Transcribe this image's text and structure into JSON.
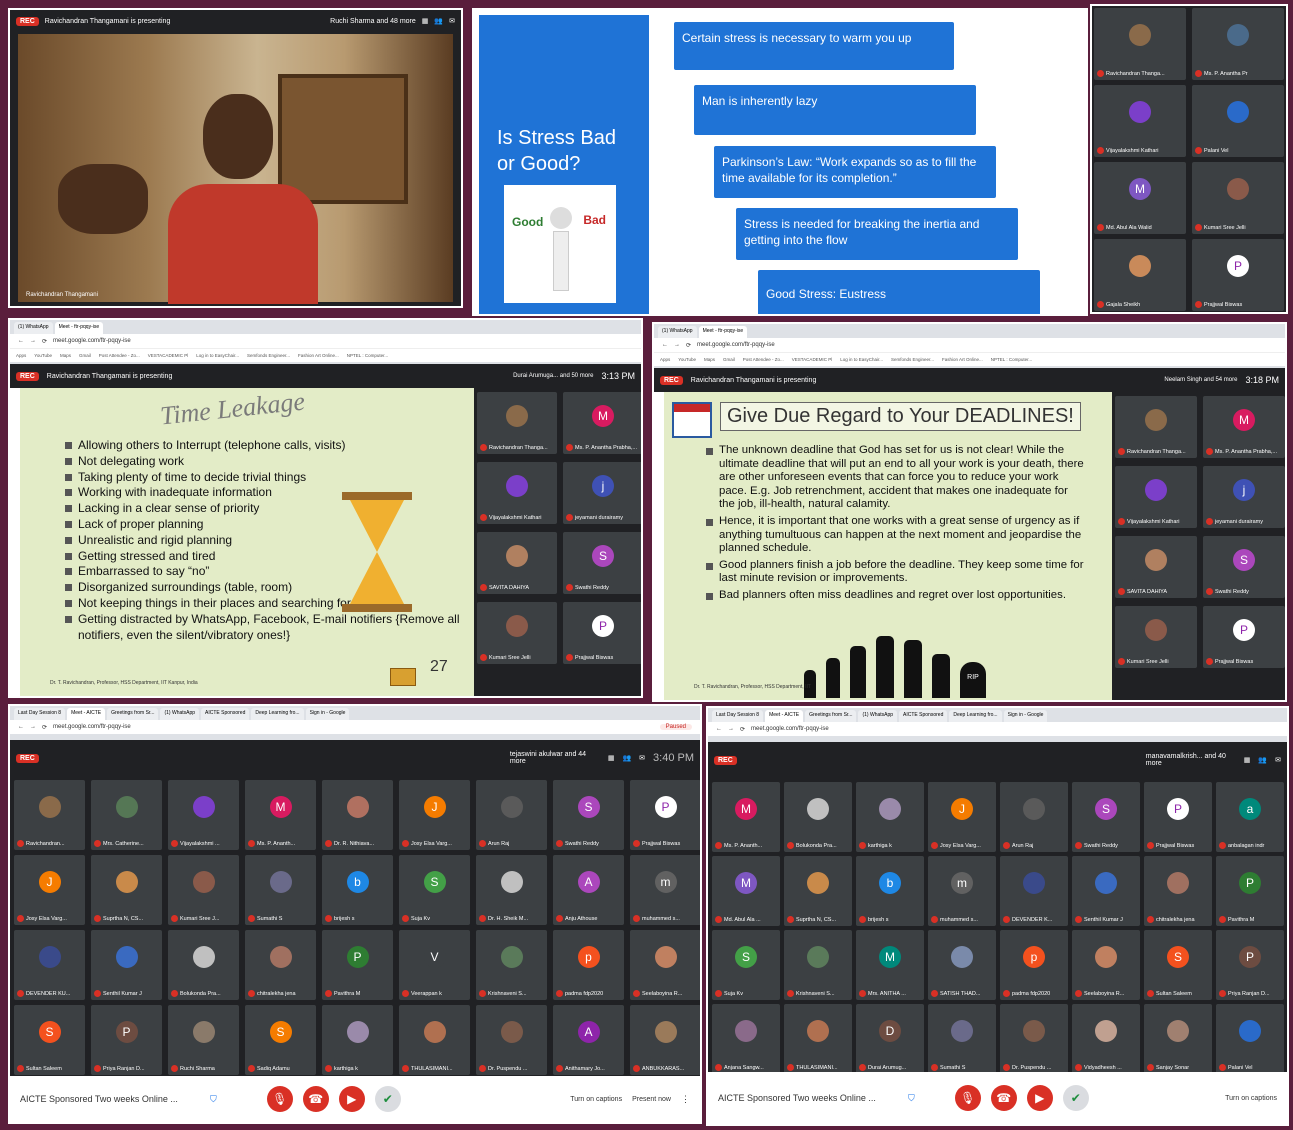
{
  "panel1": {
    "rec": "REC",
    "presenting": "Ravichandran Thangamani is presenting",
    "viewer": "Ruchi Sharma and 48 more",
    "name_tag": "Ravichandran Thangamani"
  },
  "panel2": {
    "title": "Is Stress Bad or Good?",
    "good": "Good",
    "bad": "Bad",
    "boxes": [
      "Certain stress is necessary to warm you up",
      "Man is inherently lazy",
      "Parkinson’s Law: “Work expands so as to fill the time available for its completion.”",
      "Stress is needed for breaking the inertia and getting into the flow",
      "Good Stress: Eustress"
    ]
  },
  "panel3": {
    "tiles": [
      {
        "name": "Ravichandran Thanga...",
        "letter": "",
        "color": "#8a6a4a"
      },
      {
        "name": "Ms. P. Anantha Pr",
        "letter": "",
        "color": "#4a6a8a"
      },
      {
        "name": "Vijayalakshmi Kathari",
        "letter": "",
        "color": "#7b3fc9"
      },
      {
        "name": "Palani Vel",
        "letter": "",
        "color": "#2a6ac9"
      },
      {
        "name": "Md. Abul Ala Walid",
        "letter": "M",
        "color": "#7e57c2"
      },
      {
        "name": "Kumari Sree Jelli",
        "letter": "",
        "color": "#8a5a4a"
      },
      {
        "name": "Gajala Sheikh",
        "letter": "",
        "color": "#c98a5a"
      },
      {
        "name": "Prajjwal Biswas",
        "letter": "P",
        "color": "#ffffff"
      }
    ]
  },
  "panel4": {
    "tabs": [
      "(1) WhatsApp",
      "Meet - ftr-pqqy-ise"
    ],
    "url": "meet.google.com/ftr-pqqy-ise",
    "bookmarks": [
      "Apps",
      "YouTube",
      "Maps",
      "Gmail",
      "Post Attendee - Zo...",
      "VESTACADEMIC Pl",
      "Log in to EasyChair...",
      "Semfonds Engineer...",
      "Fashion Art Online...",
      "NPTEL : Computer..."
    ],
    "rec": "REC",
    "presenting": "Ravichandran Thangamani is presenting",
    "viewer": "Durai Arumuga... and 50 more",
    "time": "3:13 PM",
    "slide_title": "Time Leakage",
    "bullets": [
      "Allowing others to Interrupt (telephone calls, visits)",
      "Not delegating work",
      "Taking plenty of time to decide trivial things",
      "Working with inadequate information",
      "Lacking in a clear sense of priority",
      "Lack of proper planning",
      "Unrealistic and rigid planning",
      "Getting stressed and tired",
      "Embarrassed to say “no”",
      "Disorganized surroundings (table, room)",
      "Not keeping things in their places and searching for them",
      "Getting distracted by WhatsApp, Facebook, E-mail notifiers {Remove all notifiers, even the silent/vibratory ones!}"
    ],
    "page_num": "27",
    "footer": "Dr. T. Ravichandran, Professor, HSS Department, IIT Kanpur, India",
    "tiles": [
      {
        "name": "Ravichandran Thanga...",
        "letter": "",
        "color": "#8a6a4a"
      },
      {
        "name": "Ms. P. Anantha Prabha,...",
        "letter": "M",
        "color": "#d81b60"
      },
      {
        "name": "Vijayalakshmi Kathari",
        "letter": "",
        "color": "#7b3fc9"
      },
      {
        "name": "jeyamani durairamy",
        "letter": "j",
        "color": "#3f51b5"
      },
      {
        "name": "SAVITA DAHIYA",
        "letter": "",
        "color": "#b08060"
      },
      {
        "name": "Swathi Reddy",
        "letter": "S",
        "color": "#ab47bc"
      },
      {
        "name": "Kumari Sree Jelli",
        "letter": "",
        "color": "#8a5a4a"
      },
      {
        "name": "Prajjwal Biswas",
        "letter": "P",
        "color": "#ffffff"
      }
    ]
  },
  "panel5": {
    "tabs": [
      "(1) WhatsApp",
      "Meet - ftr-pqqy-ise"
    ],
    "url": "meet.google.com/ftr-pqqy-ise",
    "rec": "REC",
    "presenting": "Ravichandran Thangamani is presenting",
    "viewer": "Neelam Singh and 54 more",
    "time": "3:18 PM",
    "slide_title": "Give Due Regard to Your DEADLINES!",
    "bullets": [
      "The unknown deadline that God has set for us is not clear! While the ultimate deadline that will put an end to all your work is your death, there are other unforeseen events that can force you to reduce your work pace. E.g. Job retrenchment, accident that makes one inadequate for the job, ill-health, natural calamity.",
      "Hence, it is important that one works with a great sense of urgency as if anything tumultuous can happen at the next moment and jeopardise the planned schedule.",
      "Good planners finish a job before the deadline. They keep some time for last minute revision or improvements.",
      "Bad planners often miss deadlines and regret over lost opportunities."
    ],
    "rip": "RIP",
    "footer": "Dr. T. Ravichandran, Professor, HSS Department, IIT",
    "tiles": [
      {
        "name": "Ravichandran Thanga...",
        "letter": "",
        "color": "#8a6a4a"
      },
      {
        "name": "Ms. P. Anantha Prabha,...",
        "letter": "M",
        "color": "#d81b60"
      },
      {
        "name": "Vijayalakshmi Kathari",
        "letter": "",
        "color": "#7b3fc9"
      },
      {
        "name": "jeyamani durairamy",
        "letter": "j",
        "color": "#3f51b5"
      },
      {
        "name": "SAVITA DAHIYA",
        "letter": "",
        "color": "#b08060"
      },
      {
        "name": "Swathi Reddy",
        "letter": "S",
        "color": "#ab47bc"
      },
      {
        "name": "Kumari Sree Jelli",
        "letter": "",
        "color": "#8a5a4a"
      },
      {
        "name": "Prajjwal Biswas",
        "letter": "P",
        "color": "#ffffff"
      }
    ]
  },
  "panel6": {
    "tabs": [
      "Last Day Session 8",
      "Meet - AICTE",
      "Greetings from Sr...",
      "(1) WhatsApp",
      "AICTE Sponsored",
      "Deep Learning fro...",
      "Sign in - Google"
    ],
    "url": "meet.google.com/ftr-pqqy-ise",
    "rec": "REC",
    "viewer": "tejaswini akulwar and 44 more",
    "time": "3:40 PM",
    "paused": "Paused",
    "tiles": [
      {
        "name": "Ravichandran...",
        "letter": "",
        "color": "#8a6a4a"
      },
      {
        "name": "Mrs. Catherine...",
        "letter": "",
        "color": "#557755"
      },
      {
        "name": "Vijayalakshmi ...",
        "letter": "",
        "color": "#7b3fc9"
      },
      {
        "name": "Ms. P. Ananth...",
        "letter": "M",
        "color": "#d81b60"
      },
      {
        "name": "Dr. R. Nithiava...",
        "letter": "",
        "color": "#b07060"
      },
      {
        "name": "Josy Elsa Varg...",
        "letter": "J",
        "color": "#f57c00"
      },
      {
        "name": "Arun Raj",
        "letter": "",
        "color": "#5a5a5a"
      },
      {
        "name": "Swathi Reddy",
        "letter": "S",
        "color": "#ab47bc"
      },
      {
        "name": "Prajjwal Biswas",
        "letter": "P",
        "color": "#ffffff"
      },
      {
        "name": "Josy Elsa Varg...",
        "letter": "J",
        "color": "#f57c00"
      },
      {
        "name": "Suprtha N, CS...",
        "letter": "",
        "color": "#c98a4a"
      },
      {
        "name": "Kumari Sree J...",
        "letter": "",
        "color": "#8a5a4a"
      },
      {
        "name": "Sumathi S",
        "letter": "",
        "color": "#6a6a8a"
      },
      {
        "name": "brijesh s",
        "letter": "b",
        "color": "#1e88e5"
      },
      {
        "name": "Suja Kv",
        "letter": "S",
        "color": "#43a047"
      },
      {
        "name": "Dr. H. Sheik M...",
        "letter": "",
        "color": "#c0c0c0"
      },
      {
        "name": "Anju Athouse",
        "letter": "A",
        "color": "#ab47bc"
      },
      {
        "name": "muhammed s...",
        "letter": "m",
        "color": "#616161"
      },
      {
        "name": "DEVENDER KU...",
        "letter": "",
        "color": "#3a4a8a"
      },
      {
        "name": "Senthil Kumar J",
        "letter": "",
        "color": "#3a6ac0"
      },
      {
        "name": "Bolukonda Pra...",
        "letter": "",
        "color": "#c0c0c0"
      },
      {
        "name": "chitralekha jena",
        "letter": "",
        "color": "#a07060"
      },
      {
        "name": "Pavithra M",
        "letter": "P",
        "color": "#2e7d32"
      },
      {
        "name": "Veerappan k",
        "letter": "V",
        "color": "#3c4043"
      },
      {
        "name": "Krishnaveni S...",
        "letter": "",
        "color": "#5a7a5a"
      },
      {
        "name": "padma fdp2020",
        "letter": "p",
        "color": "#f4511e"
      },
      {
        "name": "Seelaboyina R...",
        "letter": "",
        "color": "#c08060"
      },
      {
        "name": "Sultan Saleem",
        "letter": "S",
        "color": "#f4511e"
      },
      {
        "name": "Priya Ranjan D...",
        "letter": "P",
        "color": "#6d4c41"
      },
      {
        "name": "Ruchi Sharma",
        "letter": "",
        "color": "#8a7a6a"
      },
      {
        "name": "Sadiq Adamu",
        "letter": "S",
        "color": "#f57c00"
      },
      {
        "name": "karthiga k",
        "letter": "",
        "color": "#9a8aaa"
      },
      {
        "name": "THULASIMANI...",
        "letter": "",
        "color": "#b07050"
      },
      {
        "name": "Dr. Puspendu ...",
        "letter": "",
        "color": "#7a5a4a"
      },
      {
        "name": "Anithamary Jo...",
        "letter": "A",
        "color": "#8e24aa"
      },
      {
        "name": "ANBUKKARAS...",
        "letter": "",
        "color": "#9a7a5a"
      }
    ],
    "meeting_title": "AICTE Sponsored Two weeks Online ...",
    "captions": "Turn on captions",
    "present": "Present now"
  },
  "panel7": {
    "tabs": [
      "Last Day Session 8",
      "Meet - AICTE",
      "Greetings from Sr...",
      "(1) WhatsApp",
      "AICTE Sponsored",
      "Deep Learning fro...",
      "Sign in - Google"
    ],
    "url": "meet.google.com/ftr-pqqy-ise",
    "rec": "REC",
    "viewer": "manavamalkrish... and 40 more",
    "tiles": [
      {
        "name": "Ms. P. Ananth...",
        "letter": "M",
        "color": "#d81b60"
      },
      {
        "name": "Bolukonda Pra...",
        "letter": "",
        "color": "#c0c0c0"
      },
      {
        "name": "karthiga k",
        "letter": "",
        "color": "#9a8aaa"
      },
      {
        "name": "Josy Elsa Varg...",
        "letter": "J",
        "color": "#f57c00"
      },
      {
        "name": "Arun Raj",
        "letter": "",
        "color": "#5a5a5a"
      },
      {
        "name": "Swathi Reddy",
        "letter": "S",
        "color": "#ab47bc"
      },
      {
        "name": "Prajjwal Biswas",
        "letter": "P",
        "color": "#ffffff"
      },
      {
        "name": "anbalagan indr",
        "letter": "a",
        "color": "#00897b"
      },
      {
        "name": "Md. Abul Ala ...",
        "letter": "M",
        "color": "#7e57c2"
      },
      {
        "name": "Suprtha N, CS...",
        "letter": "",
        "color": "#c98a4a"
      },
      {
        "name": "brijesh s",
        "letter": "b",
        "color": "#1e88e5"
      },
      {
        "name": "muhammed s...",
        "letter": "m",
        "color": "#616161"
      },
      {
        "name": "DEVENDER K...",
        "letter": "",
        "color": "#3a4a8a"
      },
      {
        "name": "Senthil Kumar J",
        "letter": "",
        "color": "#3a6ac0"
      },
      {
        "name": "chitralekha jena",
        "letter": "",
        "color": "#a07060"
      },
      {
        "name": "Pavithra M",
        "letter": "P",
        "color": "#2e7d32"
      },
      {
        "name": "Suja Kv",
        "letter": "S",
        "color": "#43a047"
      },
      {
        "name": "Krishnaveni S...",
        "letter": "",
        "color": "#5a7a5a"
      },
      {
        "name": "Mrs. ANITHA ...",
        "letter": "M",
        "color": "#00897b"
      },
      {
        "name": "SATISH THAD...",
        "letter": "",
        "color": "#7a8aaa"
      },
      {
        "name": "padma fdp2020",
        "letter": "p",
        "color": "#f4511e"
      },
      {
        "name": "Seelaboyina R...",
        "letter": "",
        "color": "#c08060"
      },
      {
        "name": "Sultan Saleem",
        "letter": "S",
        "color": "#f4511e"
      },
      {
        "name": "Priya Ranjan D...",
        "letter": "P",
        "color": "#6d4c41"
      },
      {
        "name": "Anjana Sangw...",
        "letter": "",
        "color": "#8a6a8a"
      },
      {
        "name": "THULASIMANI...",
        "letter": "",
        "color": "#b07050"
      },
      {
        "name": "Durai Arumug...",
        "letter": "D",
        "color": "#6d4c41"
      },
      {
        "name": "Sumathi S",
        "letter": "",
        "color": "#6a6a8a"
      },
      {
        "name": "Dr. Puspendu ...",
        "letter": "",
        "color": "#7a5a4a"
      },
      {
        "name": "Vidyadheesh ...",
        "letter": "",
        "color": "#c0a090"
      },
      {
        "name": "Sanjay Sonar",
        "letter": "",
        "color": "#a08070"
      },
      {
        "name": "Palani Vel",
        "letter": "",
        "color": "#2a6ac9"
      }
    ],
    "meeting_title": "AICTE Sponsored Two weeks Online ...",
    "captions": "Turn on captions"
  }
}
